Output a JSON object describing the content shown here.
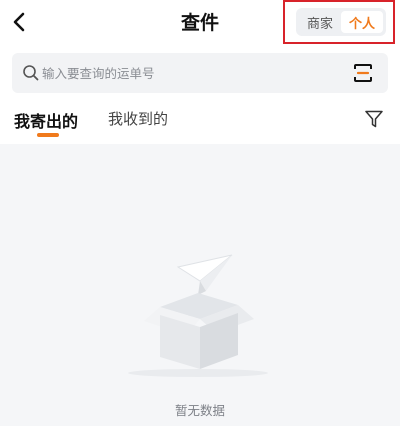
{
  "header": {
    "title": "查件",
    "back_icon": "chevron-left-icon",
    "mode_toggle": {
      "options": [
        "商家",
        "个人"
      ],
      "selected": "个人"
    }
  },
  "search": {
    "placeholder": "输入要查询的运单号",
    "value": "",
    "scan_icon": "scan-icon"
  },
  "tabs": {
    "items": [
      {
        "label": "我寄出的",
        "active": true
      },
      {
        "label": "我收到的",
        "active": false
      }
    ],
    "filter_icon": "filter-icon"
  },
  "empty_state": {
    "message": "暂无数据",
    "illustration": "empty-box-paper-plane"
  },
  "colors": {
    "accent": "#f07a1c",
    "highlight_frame": "#d8232a",
    "content_bg": "#f5f6f8"
  }
}
